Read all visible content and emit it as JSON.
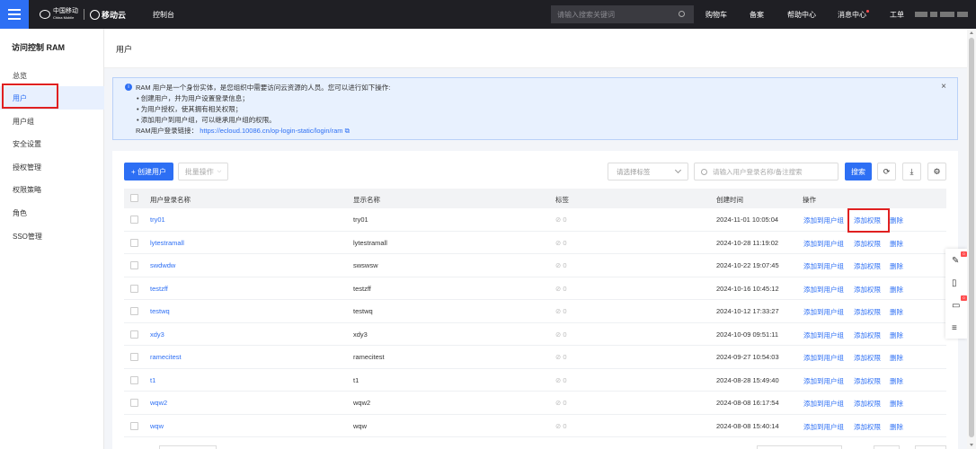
{
  "topbar": {
    "logo_cm_cn": "中国移动",
    "logo_cm_en": "China Mobile",
    "logo_yd": "移动云",
    "console": "控制台",
    "search_placeholder": "请输入搜索关键词",
    "nav": [
      "购物车",
      "备案",
      "帮助中心",
      "消息中心",
      "工单"
    ]
  },
  "sidebar": {
    "title": "访问控制 RAM",
    "items": [
      "总览",
      "用户",
      "用户组",
      "安全设置",
      "授权管理",
      "权限策略",
      "角色",
      "SSO管理"
    ],
    "active_index": 1
  },
  "page": {
    "title": "用户"
  },
  "notice": {
    "line1": "RAM 用户是一个身份实体，是您组织中需要访问云资源的人员。您可以进行如下操作:",
    "bullets": [
      "• 创建用户，并为用户设置登录信息；",
      "• 为用户授权，使其拥有相关权限；",
      "• 添加用户到用户组，可以继承用户组的权限。"
    ],
    "login_label": "RAM用户登录链接：",
    "login_url": "https://ecloud.10086.cn/op-login-static/login/ram",
    "close": "×"
  },
  "toolbar": {
    "create_user": "+ 创建用户",
    "batch": "批量操作",
    "tag_select": "请选择标签",
    "search_placeholder": "请输入用户登录名称/备注搜索",
    "search_btn": "搜索",
    "refresh_icon": "⟳",
    "download_icon": "⤓",
    "settings_icon": "⚙"
  },
  "table": {
    "headers": [
      "用户登录名称",
      "显示名称",
      "标签",
      "创建时间",
      "操作"
    ],
    "ops": [
      "添加到用户组",
      "添加权限",
      "删除"
    ],
    "rows": [
      {
        "login": "try01",
        "display": "try01",
        "tag": "0",
        "created": "2024-11-01 10:05:04"
      },
      {
        "login": "lytestramall",
        "display": "lytestramall",
        "tag": "0",
        "created": "2024-10-28 11:19:02"
      },
      {
        "login": "swdwdw",
        "display": "swswsw",
        "tag": "0",
        "created": "2024-10-22 19:07:45"
      },
      {
        "login": "testzff",
        "display": "testzff",
        "tag": "0",
        "created": "2024-10-16 10:45:12"
      },
      {
        "login": "testwq",
        "display": "testwq",
        "tag": "0",
        "created": "2024-10-12 17:33:27"
      },
      {
        "login": "xdy3",
        "display": "xdy3",
        "tag": "0",
        "created": "2024-10-09 09:51:11"
      },
      {
        "login": "ramecitest",
        "display": "ramecitest",
        "tag": "0",
        "created": "2024-09-27 10:54:03"
      },
      {
        "login": "t1",
        "display": "t1",
        "tag": "0",
        "created": "2024-08-28 15:49:40"
      },
      {
        "login": "wqw2",
        "display": "wqw2",
        "tag": "0",
        "created": "2024-08-08 16:17:54"
      },
      {
        "login": "wqw",
        "display": "wqw",
        "tag": "0",
        "created": "2024-08-08 15:40:14"
      }
    ]
  },
  "colors": {
    "primary": "#2d6ff4",
    "highlight": "#e02020",
    "topbar": "#1f1f24"
  }
}
